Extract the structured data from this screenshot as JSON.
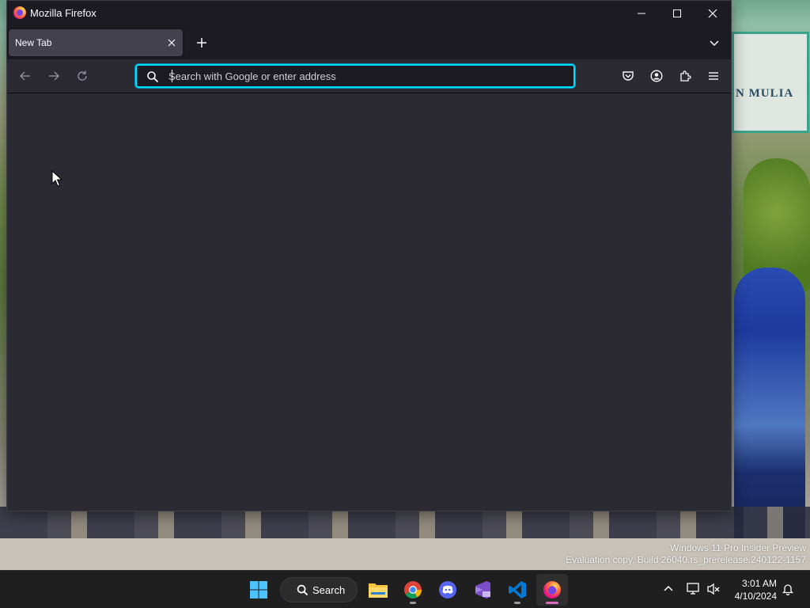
{
  "window": {
    "title": "Mozilla Firefox",
    "controls": {
      "minimize": "Minimize",
      "maximize": "Maximize",
      "close": "Close"
    }
  },
  "tabs": [
    {
      "label": "New Tab",
      "active": true
    }
  ],
  "navbar": {
    "back_icon": "back-arrow-icon",
    "forward_icon": "forward-arrow-icon",
    "reload_icon": "reload-icon",
    "url_value": "",
    "url_placeholder": "Search with Google or enter address",
    "toolbar_icons": [
      "pocket-icon",
      "account-icon",
      "extensions-icon",
      "menu-icon"
    ]
  },
  "desktop": {
    "watermark_line1": "Windows 11 Pro Insider Preview",
    "watermark_line2": "Evaluation copy. Build 26040.rs_prerelease.240122-1157"
  },
  "taskbar": {
    "search_label": "Search",
    "apps": [
      "start",
      "file-explorer",
      "chrome",
      "discord",
      "visual-studio",
      "vscode",
      "firefox"
    ],
    "active_app": "firefox",
    "clock_time": "3:01 AM",
    "clock_date": "4/10/2024"
  },
  "colors": {
    "accent_focus": "#00ddff",
    "toolbar_bg": "#2b2a33",
    "titlebar_bg": "#1c1b22",
    "taskbar_bg": "#1f1f1f"
  }
}
